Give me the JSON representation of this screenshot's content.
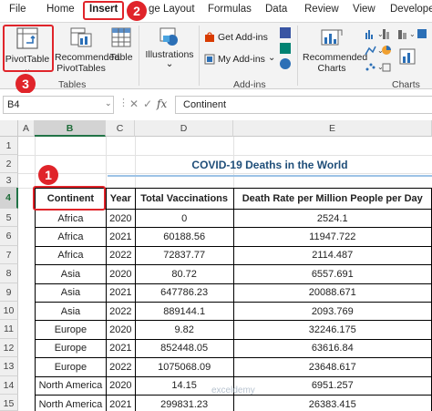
{
  "tabs": [
    "File",
    "Home",
    "Insert",
    "ge Layout",
    "Formulas",
    "Data",
    "Review",
    "View",
    "Develope"
  ],
  "ribbon": {
    "pivot_label": "PivotTable",
    "recommended_pivot_label_1": "Recommended",
    "recommended_pivot_label_2": "PivotTables",
    "table_label": "Table",
    "illustrations_label": "Illustrations",
    "get_addins": "Get Add-ins",
    "my_addins": "My Add-ins",
    "recommended_charts_1": "Recommended",
    "recommended_charts_2": "Charts",
    "groups": {
      "tables": "Tables",
      "addins": "Add-ins",
      "charts": "Charts"
    }
  },
  "formula_bar": {
    "name_box": "B4",
    "cancel": "✕",
    "enter": "✓",
    "fx": "fx",
    "content": "Continent"
  },
  "columns": [
    "A",
    "B",
    "C",
    "D",
    "E"
  ],
  "rows": [
    "1",
    "2",
    "3",
    "4",
    "5",
    "6",
    "7",
    "8",
    "9",
    "10",
    "11",
    "12",
    "13",
    "14",
    "15"
  ],
  "sheet": {
    "title": "COVID-19 Deaths in the World",
    "headers": [
      "Continent",
      "Year",
      "Total Vaccinations",
      "Death Rate per Million People per Day"
    ],
    "data": [
      [
        "Africa",
        "2020",
        "0",
        "2524.1"
      ],
      [
        "Africa",
        "2021",
        "60188.56",
        "11947.722"
      ],
      [
        "Africa",
        "2022",
        "72837.77",
        "2114.487"
      ],
      [
        "Asia",
        "2020",
        "80.72",
        "6557.691"
      ],
      [
        "Asia",
        "2021",
        "647786.23",
        "20088.671"
      ],
      [
        "Asia",
        "2022",
        "889144.1",
        "2093.769"
      ],
      [
        "Europe",
        "2020",
        "9.82",
        "32246.175"
      ],
      [
        "Europe",
        "2021",
        "852448.05",
        "63616.84"
      ],
      [
        "Europe",
        "2022",
        "1075068.09",
        "23648.617"
      ],
      [
        "North America",
        "2020",
        "14.15",
        "6951.257"
      ],
      [
        "North America",
        "2021",
        "299831.23",
        "26383.415"
      ]
    ]
  },
  "badges": [
    "1",
    "2",
    "3"
  ],
  "watermark": "exceldemy"
}
